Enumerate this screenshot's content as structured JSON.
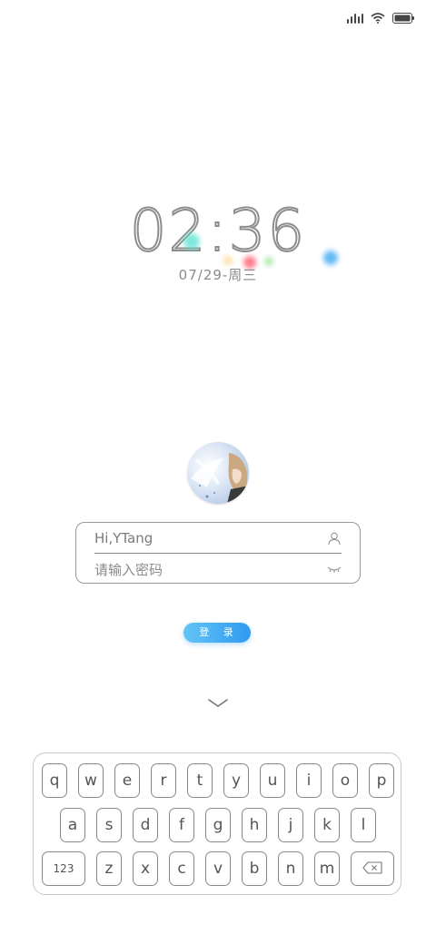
{
  "status_bar": {
    "signal_icon": "signal-icon",
    "wifi_icon": "wifi-icon",
    "battery_icon": "battery-icon"
  },
  "lockscreen": {
    "time": "02:36",
    "date": "07/29-周三"
  },
  "login": {
    "username": "Hi,YTang",
    "password_placeholder": "请输入密码",
    "user_icon": "user-icon",
    "eye_icon": "eye-closed-icon",
    "login_label": "登 录",
    "collapse_icon": "chevron-down-icon"
  },
  "keyboard": {
    "row1": [
      "q",
      "w",
      "e",
      "r",
      "t",
      "y",
      "u",
      "i",
      "o",
      "p"
    ],
    "row2": [
      "a",
      "s",
      "d",
      "f",
      "g",
      "h",
      "j",
      "k",
      "l"
    ],
    "row3": [
      "123",
      "z",
      "x",
      "c",
      "v",
      "b",
      "n",
      "m"
    ],
    "backspace_icon": "backspace-icon"
  },
  "colors": {
    "accent": "#3aa3f2",
    "border": "#9a9a9a"
  }
}
